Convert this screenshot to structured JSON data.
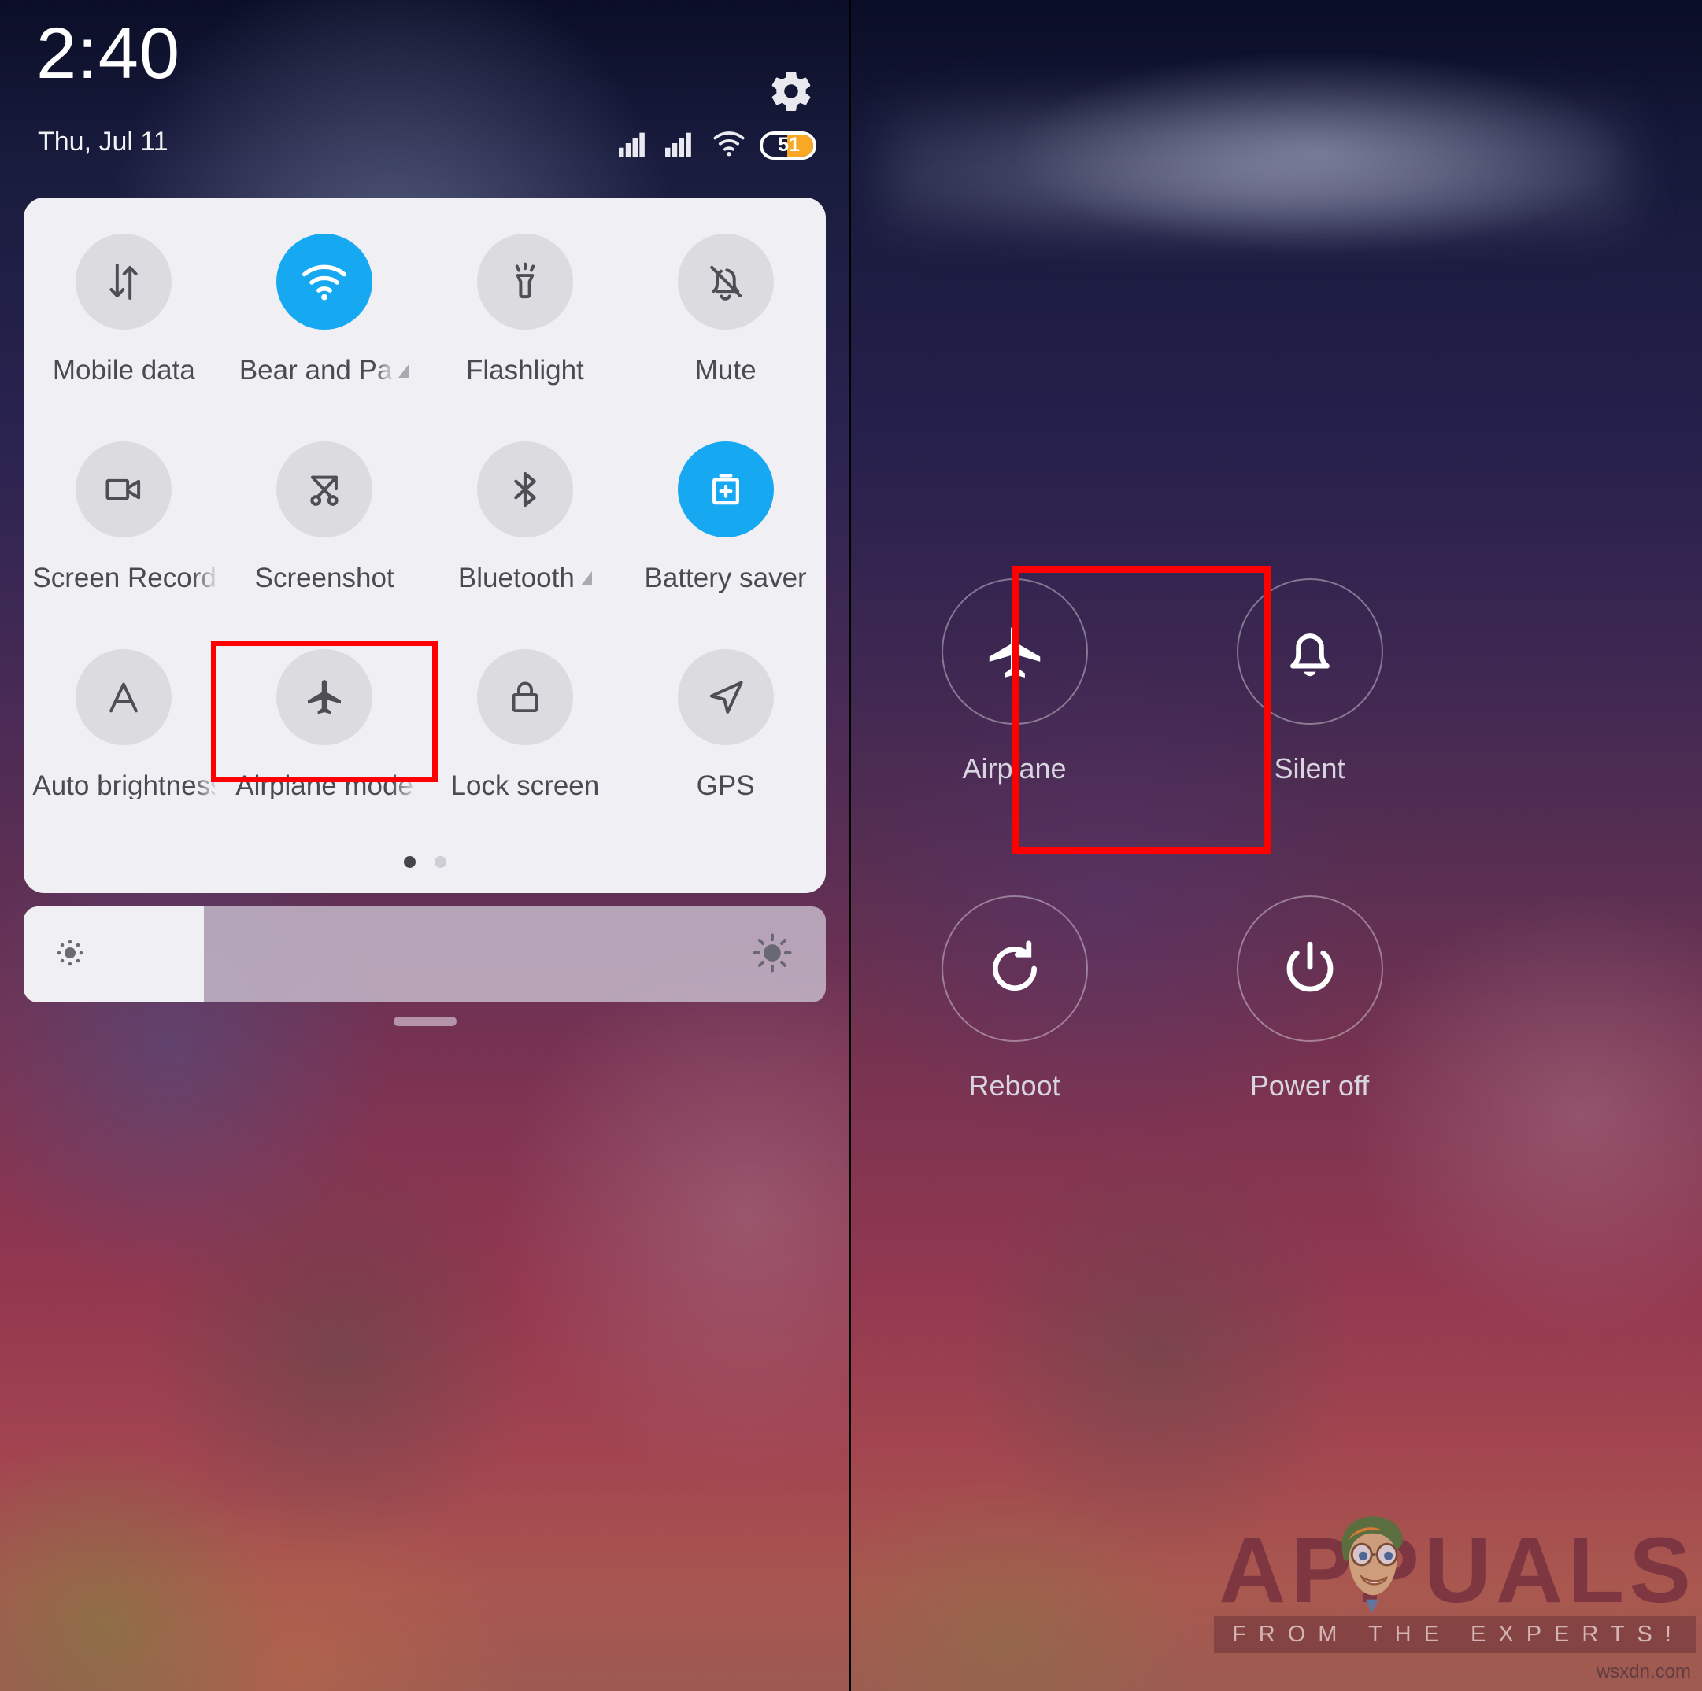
{
  "statusbar": {
    "time": "2:40",
    "date": "Thu, Jul 11",
    "settings_icon": "gear-icon",
    "signal1_icon": "signal-bars-icon",
    "signal2_icon": "signal-bars-icon",
    "wifi_icon": "wifi-icon",
    "battery_level": "51",
    "battery_percent": 51
  },
  "quick_settings": {
    "tiles": [
      {
        "label": "Mobile data",
        "icon": "mobile-data-icon",
        "active": false,
        "has_caret": false,
        "clipped": false
      },
      {
        "label": "Bear and Pa",
        "icon": "wifi-icon",
        "active": true,
        "has_caret": true,
        "clipped": true
      },
      {
        "label": "Flashlight",
        "icon": "flashlight-icon",
        "active": false,
        "has_caret": false,
        "clipped": false
      },
      {
        "label": "Mute",
        "icon": "bell-muted-icon",
        "active": false,
        "has_caret": false,
        "clipped": false
      },
      {
        "label": "Screen Record",
        "icon": "video-camera-icon",
        "active": false,
        "has_caret": false,
        "clipped": true
      },
      {
        "label": "Screenshot",
        "icon": "scissors-icon",
        "active": false,
        "has_caret": false,
        "clipped": false
      },
      {
        "label": "Bluetooth",
        "icon": "bluetooth-icon",
        "active": false,
        "has_caret": true,
        "clipped": false
      },
      {
        "label": "Battery saver",
        "icon": "battery-plus-icon",
        "active": true,
        "has_caret": false,
        "clipped": false
      },
      {
        "label": "Auto brightness",
        "icon": "letter-a-icon",
        "active": false,
        "has_caret": false,
        "clipped": true
      },
      {
        "label": "Airplane mode",
        "icon": "airplane-icon",
        "active": false,
        "has_caret": false,
        "clipped": true
      },
      {
        "label": "Lock screen",
        "icon": "padlock-icon",
        "active": false,
        "has_caret": false,
        "clipped": false
      },
      {
        "label": "GPS",
        "icon": "location-arrow-icon",
        "active": false,
        "has_caret": false,
        "clipped": false
      }
    ],
    "page_count": 2,
    "current_page": 1
  },
  "brightness": {
    "low_icon": "brightness-low-icon",
    "high_icon": "brightness-high-icon",
    "value_percent": 22
  },
  "power_menu": {
    "items": [
      {
        "label": "Airplane",
        "icon": "airplane-icon"
      },
      {
        "label": "Silent",
        "icon": "bell-icon"
      },
      {
        "label": "Reboot",
        "icon": "refresh-icon"
      },
      {
        "label": "Power off",
        "icon": "power-icon"
      }
    ]
  },
  "highlights": {
    "left_target": "Airplane mode",
    "right_target": "Airplane",
    "color": "#fe0000"
  },
  "watermark": {
    "brand": "APPUALS",
    "tagline": "FROM THE EXPERTS!",
    "domain": "wsxdn.com"
  },
  "colors": {
    "accent_on": "#17a8f2",
    "tile_off": "#dcdce0",
    "card_bg": "#f0eff3",
    "battery_fill": "#f9a825",
    "highlight": "#fe0000"
  }
}
